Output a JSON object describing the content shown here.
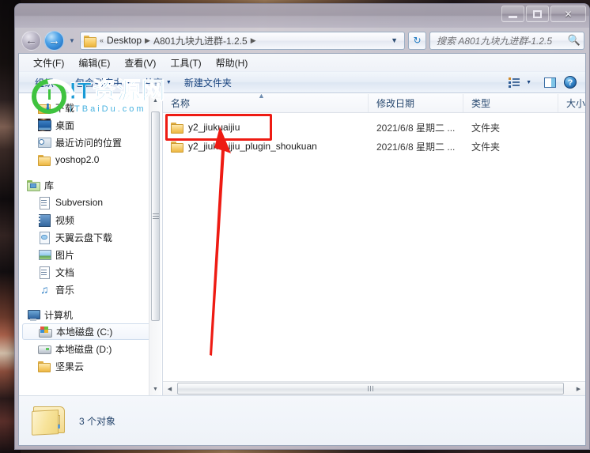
{
  "window": {
    "title": "",
    "controls": {
      "minimize": "─",
      "maximize": "□",
      "close": "✕"
    }
  },
  "navbar": {
    "back_icon": "back-arrow",
    "forward_icon": "forward-arrow",
    "history_caret": "▼",
    "breadcrumb": {
      "prefix": "«",
      "items": [
        "Desktop",
        "A801九块九进群-1.2.5"
      ],
      "separator": "▶",
      "dropdown_caret": "▼"
    },
    "refresh_icon": "↻",
    "search": {
      "placeholder": "搜索 A801九块九进群-1.2.5",
      "value": "",
      "icon": "magnifier"
    }
  },
  "menubar": {
    "items": [
      "文件(F)",
      "编辑(E)",
      "查看(V)",
      "工具(T)",
      "帮助(H)"
    ]
  },
  "toolbar": {
    "items": [
      {
        "label": "组织",
        "caret": "▼"
      },
      {
        "label": "包含到库中",
        "caret": "▼"
      },
      {
        "label": "共享",
        "caret": "▼"
      },
      {
        "label": "新建文件夹",
        "caret": ""
      }
    ],
    "views_caret": "▼",
    "icons": {
      "views": "list-view-icon",
      "preview_pane": "preview-pane-icon",
      "help": "?"
    }
  },
  "sidebar": {
    "groups": [
      {
        "items": [
          {
            "label": "下载",
            "icon": "download-folder-icon",
            "selected": false
          },
          {
            "label": "桌面",
            "icon": "desktop-icon",
            "selected": false
          },
          {
            "label": "最近访问的位置",
            "icon": "recent-places-icon",
            "selected": false
          },
          {
            "label": "yoshop2.0",
            "icon": "folder-icon",
            "selected": false
          }
        ]
      },
      {
        "header": {
          "label": "库",
          "icon": "library-icon"
        },
        "items": [
          {
            "label": "Subversion",
            "icon": "document-library-icon",
            "selected": false
          },
          {
            "label": "视频",
            "icon": "video-library-icon",
            "selected": false
          },
          {
            "label": "天翼云盘下载",
            "icon": "cloud-library-icon",
            "selected": false
          },
          {
            "label": "图片",
            "icon": "pictures-library-icon",
            "selected": false
          },
          {
            "label": "文档",
            "icon": "documents-library-icon",
            "selected": false
          },
          {
            "label": "音乐",
            "icon": "music-library-icon",
            "selected": false
          }
        ]
      },
      {
        "header": {
          "label": "计算机",
          "icon": "computer-icon"
        },
        "items": [
          {
            "label": "本地磁盘 (C:)",
            "icon": "windows-drive-icon",
            "selected": true
          },
          {
            "label": "本地磁盘 (D:)",
            "icon": "drive-icon",
            "selected": false
          },
          {
            "label": "坚果云",
            "icon": "folder-icon",
            "selected": false
          }
        ]
      }
    ],
    "scrollbar": {
      "up": "▲",
      "down": "▼"
    }
  },
  "filelist": {
    "columns": [
      {
        "key": "name",
        "label": "名称",
        "sorted": true,
        "sort_arrow": "▲"
      },
      {
        "key": "date",
        "label": "修改日期",
        "sorted": false,
        "sort_arrow": ""
      },
      {
        "key": "type",
        "label": "类型",
        "sorted": false,
        "sort_arrow": ""
      },
      {
        "key": "size",
        "label": "大小",
        "sorted": false,
        "sort_arrow": ""
      }
    ],
    "rows": [
      {
        "name": "y2_jiukuaijiu",
        "date": "2021/6/8 星期二 ...",
        "type": "文件夹",
        "size": "",
        "icon": "folder-icon",
        "highlighted": true
      },
      {
        "name": "y2_jiukuaijiu_plugin_shoukuan",
        "date": "2021/6/8 星期二 ...",
        "type": "文件夹",
        "size": "",
        "icon": "folder-icon",
        "highlighted": false
      }
    ],
    "hscroll": {
      "left": "◀",
      "right": "▶"
    }
  },
  "statusbar": {
    "icon": "big-folder-icon",
    "text": "3 个对象"
  },
  "annotation": {
    "box_color": "#ee1b13",
    "arrow_color": "#ee1b13",
    "target": "y2_jiukuaijiu"
  },
  "watermarks": {
    "primary": {
      "title": "IT资源网",
      "subtitle": "ITBaiDu.com"
    },
    "secondary": "IT资源网"
  },
  "colors": {
    "accent": "#1a9ad6",
    "annotation": "#ee1b13",
    "header_text": "#27486f",
    "toolbar_text": "#17427e"
  }
}
